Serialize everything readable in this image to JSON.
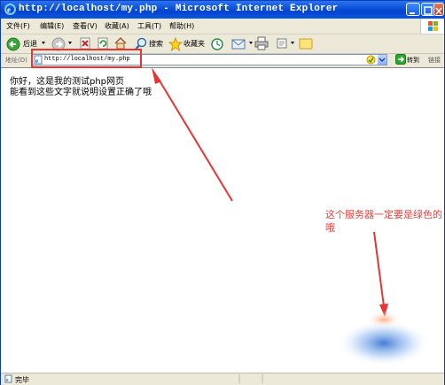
{
  "window": {
    "title": "http://localhost/my.php - Microsoft Internet Explorer"
  },
  "menu": {
    "items": [
      "文件(F)",
      "编辑(E)",
      "查看(V)",
      "收藏(A)",
      "工具(T)",
      "帮助(H)"
    ]
  },
  "toolbar": {
    "back_label": "后退",
    "search_label": "搜索",
    "favorites_label": "收藏夹"
  },
  "address": {
    "label": "地址(D)",
    "url": "http://localhost/my.php",
    "go_label": "转到",
    "links_label": "链接"
  },
  "page": {
    "line1": "你好，这是我的测试php网页",
    "line2": "能看到这些文字就说明设置正确了哦"
  },
  "status": {
    "text": "完毕"
  },
  "annotation": {
    "text": "这个服务器一定要是绿色的哦"
  },
  "colors": {
    "titlebar": "#0a4fd6",
    "annotation": "#e73535",
    "go_arrow": "#2ea52e"
  }
}
